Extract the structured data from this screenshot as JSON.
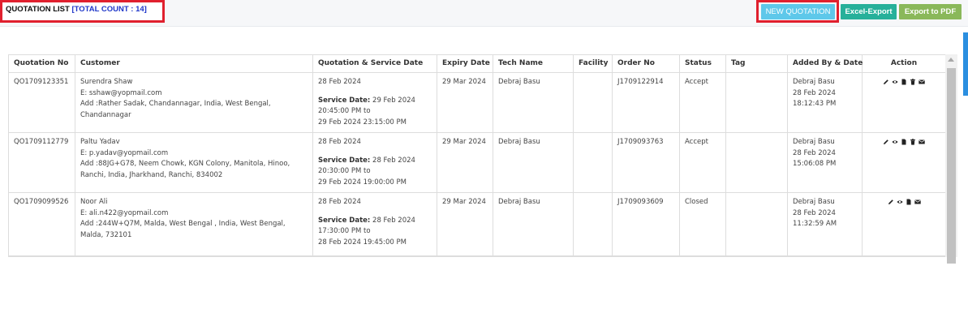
{
  "header": {
    "title": "QUOTATION LIST",
    "count_text": "[TOTAL COUNT : 14]",
    "new_button": "NEW QUOTATION",
    "excel_button": "Excel-Export",
    "pdf_button": "Export to PDF"
  },
  "table": {
    "columns": [
      "Quotation No",
      "Customer",
      "Quotation & Service Date",
      "Expiry Date",
      "Tech Name",
      "Facility",
      "Order No",
      "Status",
      "Tag",
      "Added By & Date",
      "Action"
    ],
    "service_label": "Service Date:",
    "rows": [
      {
        "quotation_no": "QO1709123351",
        "customer_name": "Surendra Shaw",
        "customer_email": "E: sshaw@yopmail.com",
        "customer_address": "Add :Rather Sadak, Chandannagar, India, West Bengal, Chandannagar",
        "quotation_date": "28 Feb 2024",
        "service_date": "29 Feb 2024",
        "service_time_from": "20:45:00 PM to",
        "service_time_to": "29 Feb 2024 23:15:00 PM",
        "expiry": "29 Mar 2024",
        "tech": "Debraj Basu",
        "facility": "",
        "order_no": "J1709122914",
        "status": "Accept",
        "tag": "",
        "added_by": "Debraj Basu",
        "added_date": "28 Feb 2024",
        "added_time": "18:12:43 PM",
        "actions": [
          "pencil-icon",
          "eye-icon",
          "file-icon",
          "trash-icon",
          "envelope-icon"
        ]
      },
      {
        "quotation_no": "QO1709112779",
        "customer_name": "Paltu Yadav",
        "customer_email": "E: p.yadav@yopmail.com",
        "customer_address": "Add :88JG+G78, Neem Chowk, KGN Colony, Manitola, Hinoo, Ranchi, India, Jharkhand, Ranchi, 834002",
        "quotation_date": "28 Feb 2024",
        "service_date": "28 Feb 2024",
        "service_time_from": "20:30:00 PM to",
        "service_time_to": "29 Feb 2024 19:00:00 PM",
        "expiry": "29 Mar 2024",
        "tech": "Debraj Basu",
        "facility": "",
        "order_no": "J1709093763",
        "status": "Accept",
        "tag": "",
        "added_by": "Debraj Basu",
        "added_date": "28 Feb 2024",
        "added_time": "15:06:08 PM",
        "actions": [
          "pencil-icon",
          "eye-icon",
          "file-icon",
          "trash-icon",
          "envelope-icon"
        ]
      },
      {
        "quotation_no": "QO1709099526",
        "customer_name": "Noor Ali",
        "customer_email": "E: ali.n422@yopmail.com",
        "customer_address": "Add :244W+Q7M, Malda, West Bengal , India, West Bengal, Malda, 732101",
        "quotation_date": "28 Feb 2024",
        "service_date": "28 Feb 2024",
        "service_time_from": "17:30:00 PM to",
        "service_time_to": "28 Feb 2024 19:45:00 PM",
        "expiry": "29 Mar 2024",
        "tech": "Debraj Basu",
        "facility": "",
        "order_no": "J1709093609",
        "status": "Closed",
        "tag": "",
        "added_by": "Debraj Basu",
        "added_date": "28 Feb 2024",
        "added_time": "11:32:59 AM",
        "actions": [
          "pencil-icon",
          "eye-icon",
          "file-icon",
          "envelope-icon"
        ]
      }
    ]
  }
}
